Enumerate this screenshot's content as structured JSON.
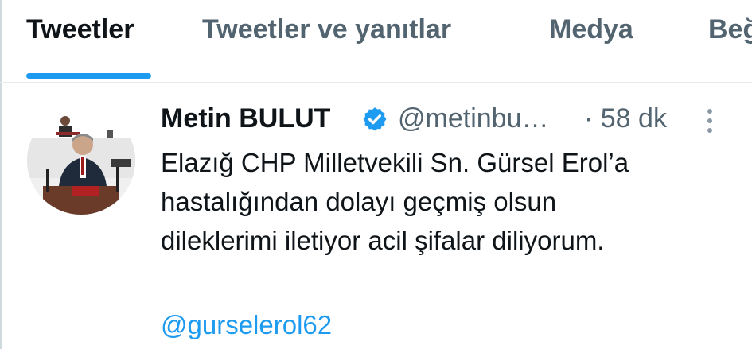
{
  "tabs": [
    {
      "label": "Tweetler",
      "active": true
    },
    {
      "label": "Tweetler ve yanıtlar",
      "active": false
    },
    {
      "label": "Medya",
      "active": false
    },
    {
      "label": "Beğ",
      "active": false
    }
  ],
  "tweet": {
    "author_name": "Metin BULUT",
    "handle": "@metinbu…",
    "time": "· 58 dk",
    "verified": true,
    "text_lines": [
      "Elazığ CHP Milletvekili Sn. Gürsel Erol’a",
      "hastalığından dolayı geçmiş olsun",
      "dileklerimi iletiyor acil şifalar diliyorum."
    ],
    "mention": "@gurselerol62"
  },
  "icons": {
    "verified": "verified-badge-icon",
    "more": "more-vertical-icon"
  },
  "colors": {
    "accent": "#1d9bf0",
    "primary_text": "#0f1419",
    "secondary_text": "#536471"
  }
}
